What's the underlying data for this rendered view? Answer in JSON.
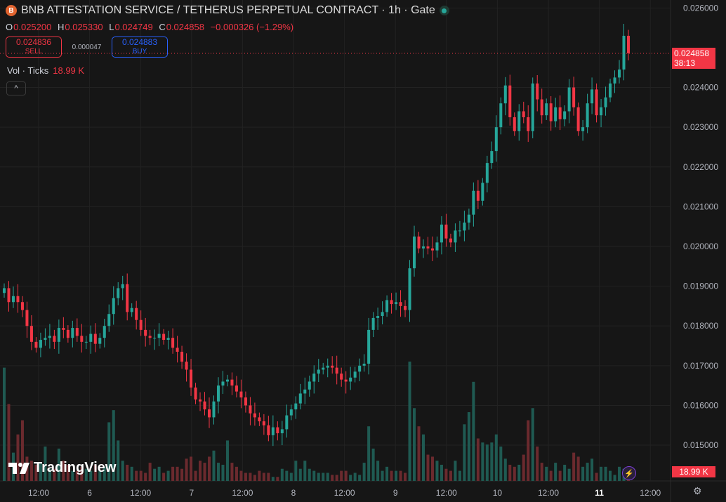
{
  "header": {
    "title": "BNB ATTESTATION SERVICE / TETHERUS PERPETUAL CONTRACT · 1h · Gate",
    "open_label": "O",
    "open": "0.025200",
    "high_label": "H",
    "high": "0.025330",
    "low_label": "L",
    "low": "0.024749",
    "close_label": "C",
    "close": "0.024858",
    "change": "−0.000326 (−1.29%)"
  },
  "trade": {
    "sell_price": "0.024836",
    "sell_label": "SELL",
    "spread": "0.000047",
    "buy_price": "0.024883",
    "buy_label": "BUY"
  },
  "volume": {
    "label": "Vol · Ticks",
    "value": "18.99 K"
  },
  "collapse_icon": "^",
  "logo_text": "TradingView",
  "last_price": "0.024858",
  "countdown": "38:13",
  "volume_badge": "18.99 K",
  "colors": {
    "up": "#26a69a",
    "down": "#f23645",
    "up_vol": "#1f5a52",
    "down_vol": "#6b2a2e",
    "background": "#161616"
  },
  "chart_data": {
    "type": "candlestick",
    "y_ticks": [
      "0.026000",
      "0.024000",
      "0.023000",
      "0.022000",
      "0.021000",
      "0.020000",
      "0.019000",
      "0.018000",
      "0.017000",
      "0.016000",
      "0.015000"
    ],
    "x_ticks": [
      "12:00",
      "6",
      "12:00",
      "7",
      "12:00",
      "8",
      "12:00",
      "9",
      "12:00",
      "10",
      "12:00",
      "11",
      "12:00"
    ],
    "ylim": [
      0.0141,
      0.0262
    ],
    "last_price": 0.024858,
    "closes": [
      0.01895,
      0.0186,
      0.01875,
      0.0186,
      0.0184,
      0.018,
      0.0176,
      0.01745,
      0.01765,
      0.0177,
      0.01775,
      0.0176,
      0.01795,
      0.0179,
      0.0177,
      0.01795,
      0.01775,
      0.0176,
      0.0176,
      0.0178,
      0.01755,
      0.0177,
      0.018,
      0.0183,
      0.0187,
      0.01895,
      0.01905,
      0.01835,
      0.01845,
      0.01815,
      0.0179,
      0.01775,
      0.0177,
      0.0177,
      0.0178,
      0.01765,
      0.0177,
      0.01745,
      0.01735,
      0.0171,
      0.0169,
      0.01645,
      0.01615,
      0.0161,
      0.0159,
      0.0157,
      0.0161,
      0.0165,
      0.0166,
      0.01665,
      0.0165,
      0.01635,
      0.0162,
      0.016,
      0.0158,
      0.0157,
      0.0156,
      0.0155,
      0.01525,
      0.01545,
      0.0153,
      0.0154,
      0.01575,
      0.0159,
      0.01605,
      0.0163,
      0.0164,
      0.0166,
      0.0168,
      0.0169,
      0.01695,
      0.017,
      0.01695,
      0.0168,
      0.01665,
      0.0166,
      0.0167,
      0.01685,
      0.017,
      0.01705,
      0.0179,
      0.0182,
      0.01825,
      0.01835,
      0.01865,
      0.01855,
      0.0186,
      0.0185,
      0.0184,
      0.01945,
      0.02025,
      0.01995,
      0.02,
      0.01995,
      0.0199,
      0.0201,
      0.02055,
      0.0202,
      0.0201,
      0.0204,
      0.0204,
      0.0206,
      0.0208,
      0.0214,
      0.02115,
      0.0216,
      0.0221,
      0.0224,
      0.023,
      0.0236,
      0.02405,
      0.02325,
      0.0229,
      0.0234,
      0.02325,
      0.0229,
      0.0241,
      0.0237,
      0.0233,
      0.0236,
      0.02315,
      0.0235,
      0.0232,
      0.0234,
      0.024,
      0.0235,
      0.0229,
      0.023,
      0.0236,
      0.02395,
      0.0233,
      0.0235,
      0.02375,
      0.0241,
      0.02425,
      0.02445,
      0.0253,
      0.02486
    ],
    "volumes": [
      0.56,
      0.38,
      0.14,
      0.23,
      0.3,
      0.12,
      0.1,
      0.08,
      0.09,
      0.17,
      0.06,
      0.06,
      0.16,
      0.1,
      0.08,
      0.05,
      0.05,
      0.07,
      0.06,
      0.05,
      0.08,
      0.05,
      0.07,
      0.29,
      0.35,
      0.2,
      0.1,
      0.08,
      0.07,
      0.05,
      0.05,
      0.04,
      0.09,
      0.06,
      0.07,
      0.04,
      0.05,
      0.07,
      0.07,
      0.06,
      0.11,
      0.12,
      0.05,
      0.1,
      0.09,
      0.12,
      0.15,
      0.09,
      0.08,
      0.2,
      0.09,
      0.07,
      0.05,
      0.04,
      0.04,
      0.03,
      0.05,
      0.04,
      0.04,
      0.02,
      0.02,
      0.06,
      0.05,
      0.04,
      0.1,
      0.06,
      0.1,
      0.06,
      0.05,
      0.04,
      0.04,
      0.04,
      0.03,
      0.03,
      0.05,
      0.05,
      0.03,
      0.04,
      0.03,
      0.09,
      0.27,
      0.16,
      0.1,
      0.05,
      0.07,
      0.05,
      0.05,
      0.05,
      0.04,
      0.59,
      0.36,
      0.27,
      0.23,
      0.13,
      0.12,
      0.1,
      0.08,
      0.06,
      0.05,
      0.1,
      0.05,
      0.28,
      0.34,
      0.49,
      0.21,
      0.19,
      0.18,
      0.19,
      0.23,
      0.17,
      0.11,
      0.08,
      0.07,
      0.08,
      0.13,
      0.3,
      0.36,
      0.17,
      0.09,
      0.07,
      0.05,
      0.09,
      0.05,
      0.08,
      0.06,
      0.14,
      0.12,
      0.07,
      0.09,
      0.11,
      0.04,
      0.07,
      0.07,
      0.05,
      0.03,
      0.07,
      0.06,
      0.05,
      0.11
    ]
  }
}
